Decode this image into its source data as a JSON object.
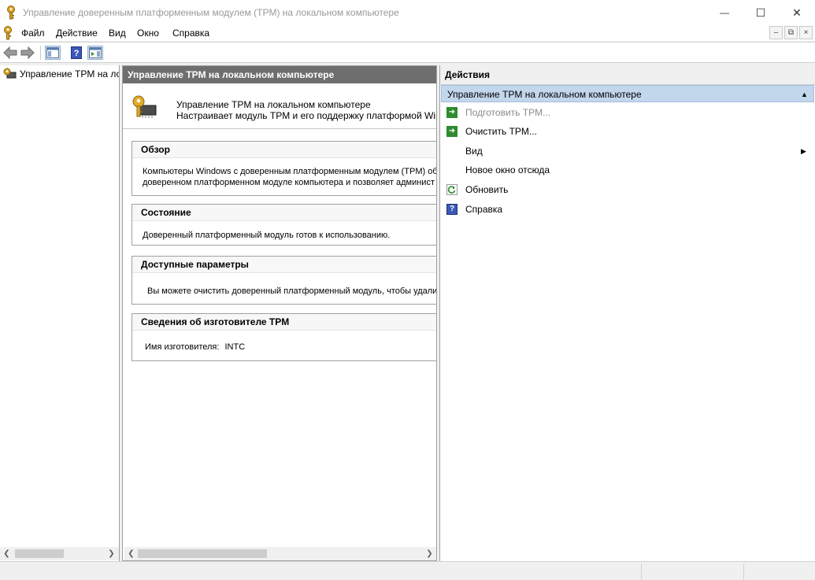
{
  "window": {
    "title": "Управление доверенным платформенным модулем (TPM) на локальном компьютере",
    "controls": {
      "minimize": "—",
      "maximize": "☐",
      "close": "✕"
    }
  },
  "menu": {
    "items": [
      "Файл",
      "Действие",
      "Вид",
      "Окно",
      "Справка"
    ],
    "mdi_controls": {
      "minimize": "–",
      "restore": "⧉",
      "close": "×"
    }
  },
  "tree": {
    "root_label": "Управление TPM на локальном компьютере"
  },
  "center": {
    "header": "Управление TPM на локальном компьютере",
    "banner": {
      "title": "Управление TPM на локальном компьютере",
      "subtitle": "Настраивает модуль TPM и его поддержку платформой Windows"
    },
    "sections": [
      {
        "title": "Обзор",
        "lines": [
          "Компьютеры Windows с доверенным платформенным модулем (TPM) об",
          "доверенном платформенном модуле компьютера и позволяет админист"
        ]
      },
      {
        "title": "Состояние",
        "lines": [
          "Доверенный платформенный модуль готов к использованию."
        ]
      },
      {
        "title": "Доступные параметры",
        "lines": [
          "Вы можете очистить доверенный платформенный модуль, чтобы удали"
        ]
      },
      {
        "title": "Сведения об изготовителе TPM",
        "manufacturer_label": "Имя изготовителя:",
        "manufacturer_value": "INTC"
      }
    ]
  },
  "actions": {
    "header": "Действия",
    "group_title": "Управление TPM на локальном компьютере",
    "items": [
      {
        "label": "Подготовить TPM...",
        "icon": "green-arrow-icon",
        "disabled": true
      },
      {
        "label": "Очистить TPM...",
        "icon": "green-arrow-icon",
        "disabled": false
      },
      {
        "label": "Вид",
        "icon": "",
        "submenu": true
      },
      {
        "label": "Новое окно отсюда",
        "icon": ""
      },
      {
        "label": "Обновить",
        "icon": "refresh-icon"
      },
      {
        "label": "Справка",
        "icon": "help-icon"
      }
    ]
  },
  "colors": {
    "center_header_bg": "#6e6e6e",
    "actions_group_bg": "#c2d6ec",
    "green_icon": "#2e8b2e",
    "help_blue": "#3a58b8"
  }
}
